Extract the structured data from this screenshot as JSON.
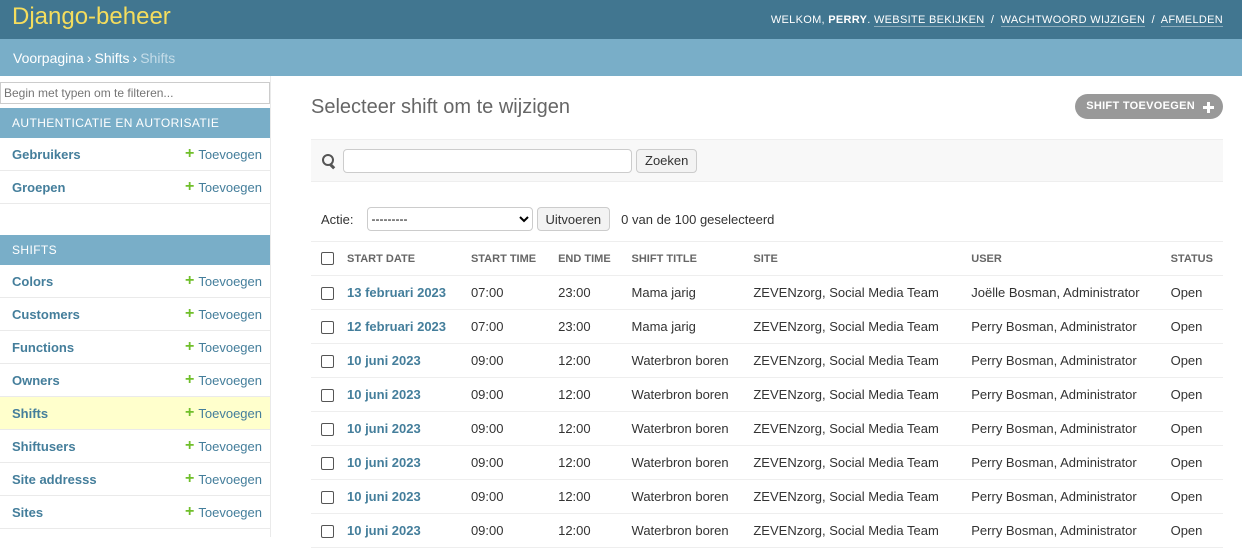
{
  "header": {
    "branding": "Django-beheer",
    "welcome": "Welkom,",
    "username": "Perry",
    "links": [
      "Website bekijken",
      "Wachtwoord wijzigen",
      "Afmelden"
    ]
  },
  "breadcrumbs": {
    "home": "Voorpagina",
    "app": "Shifts",
    "current": "Shifts",
    "sep": "›"
  },
  "sidebar": {
    "filter_placeholder": "Begin met typen om te filteren...",
    "add_label": "Toevoegen",
    "modules": [
      {
        "caption": "Authenticatie en autorisatie",
        "items": [
          "Gebruikers",
          "Groepen"
        ]
      },
      {
        "caption": "Shifts",
        "items": [
          "Colors",
          "Customers",
          "Functions",
          "Owners",
          "Shifts",
          "Shiftusers",
          "Site addresss",
          "Sites"
        ]
      }
    ],
    "current_item": "Shifts"
  },
  "content": {
    "title": "Selecteer shift om te wijzigen",
    "add_button": "Shift toevoegen",
    "search_button": "Zoeken",
    "action_label": "Actie:",
    "action_default": "---------",
    "action_go": "Uitvoeren",
    "action_counter": "0 van de 100 geselecteerd"
  },
  "table": {
    "columns": [
      "Start date",
      "Start time",
      "End time",
      "Shift title",
      "Site",
      "User",
      "Status"
    ],
    "rows": [
      [
        "13 februari 2023",
        "07:00",
        "23:00",
        "Mama jarig",
        "ZEVENzorg, Social Media Team",
        "Joëlle Bosman, Administrator",
        "Open"
      ],
      [
        "12 februari 2023",
        "07:00",
        "23:00",
        "Mama jarig",
        "ZEVENzorg, Social Media Team",
        "Perry Bosman, Administrator",
        "Open"
      ],
      [
        "10 juni 2023",
        "09:00",
        "12:00",
        "Waterbron boren",
        "ZEVENzorg, Social Media Team",
        "Perry Bosman, Administrator",
        "Open"
      ],
      [
        "10 juni 2023",
        "09:00",
        "12:00",
        "Waterbron boren",
        "ZEVENzorg, Social Media Team",
        "Perry Bosman, Administrator",
        "Open"
      ],
      [
        "10 juni 2023",
        "09:00",
        "12:00",
        "Waterbron boren",
        "ZEVENzorg, Social Media Team",
        "Perry Bosman, Administrator",
        "Open"
      ],
      [
        "10 juni 2023",
        "09:00",
        "12:00",
        "Waterbron boren",
        "ZEVENzorg, Social Media Team",
        "Perry Bosman, Administrator",
        "Open"
      ],
      [
        "10 juni 2023",
        "09:00",
        "12:00",
        "Waterbron boren",
        "ZEVENzorg, Social Media Team",
        "Perry Bosman, Administrator",
        "Open"
      ],
      [
        "10 juni 2023",
        "09:00",
        "12:00",
        "Waterbron boren",
        "ZEVENzorg, Social Media Team",
        "Perry Bosman, Administrator",
        "Open"
      ]
    ]
  },
  "colors": {
    "header_bg": "#417690",
    "breadcrumb_bg": "#79aec8",
    "link": "#447e9b",
    "branding": "#f5dd5d",
    "add_green": "#70bf2b",
    "current_row": "#ffffcc"
  },
  "icons": {
    "search": "search-icon",
    "add": "plus-icon"
  }
}
